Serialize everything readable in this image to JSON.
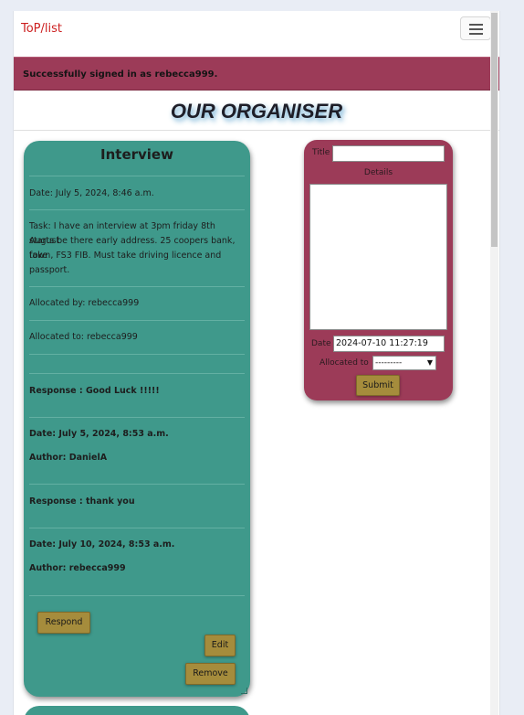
{
  "navbar": {
    "brand": "ToP/list",
    "menu_icon": "hamburger-icon"
  },
  "alert": {
    "message": "Successfully signed in as rebecca999."
  },
  "page": {
    "heading": "OUR ORGANISER"
  },
  "task": {
    "title": "Interview",
    "date": "Date: July 5, 2024, 8:46 a.m.",
    "task_lines": [
      "Task: I have an interview at 3pm friday 8th August",
      "starts be there early address. 25 coopers bank, fake",
      "town, FS3 FIB. Must take driving licence and",
      "passport."
    ],
    "allocated_by": "Allocated by: rebecca999",
    "allocated_to": "Allocated to: rebecca999",
    "responses": [
      {
        "response": "Response : Good Luck !!!!!",
        "date": "Date: July 5, 2024, 8:53 a.m.",
        "author": "Author: DanielA"
      },
      {
        "response": "Response : thank you",
        "date": "Date: July 10, 2024, 8:53 a.m.",
        "author": "Author: rebecca999"
      }
    ],
    "buttons": {
      "respond": "Respond",
      "edit": "Edit",
      "remove": "Remove"
    }
  },
  "form": {
    "title_label": "Title",
    "title_value": "",
    "details_label": "Details",
    "details_value": "",
    "date_label": "Date",
    "date_value": "2024-07-10 11:27:19",
    "allocated_label": "Allocated to",
    "allocated_selected": "---------",
    "submit_label": "Submit"
  },
  "colors": {
    "task_card": "#3f998b",
    "form_card": "#9c3b58",
    "alert": "#9c3b58",
    "button": "#a58c3c",
    "brand": "#cc1f1f"
  }
}
